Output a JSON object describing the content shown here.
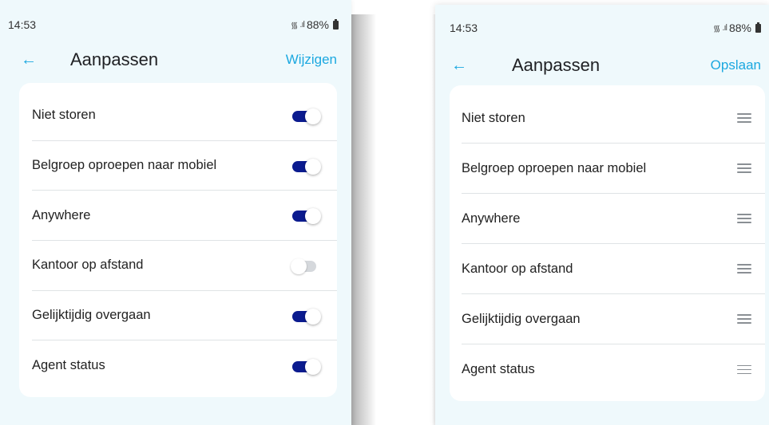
{
  "left_screen": {
    "status": {
      "time": "14:53",
      "battery": "88%"
    },
    "header": {
      "back_icon": "arrow-left-icon",
      "title": "Aanpassen",
      "action": "Wijzigen"
    },
    "colors": {
      "accent": "#1ba8e0",
      "toggle_on": "#0b1b8f",
      "toggle_off": "#d5d8dc",
      "background": "#eff9fc"
    },
    "items": [
      {
        "label": "Niet storen",
        "enabled": true
      },
      {
        "label": "Belgroep oproepen naar mobiel",
        "enabled": true
      },
      {
        "label": "Anywhere",
        "enabled": true
      },
      {
        "label": "Kantoor op afstand",
        "enabled": false
      },
      {
        "label": "Gelijktijdig overgaan",
        "enabled": true
      },
      {
        "label": "Agent status",
        "enabled": true
      }
    ]
  },
  "right_screen": {
    "status": {
      "time": "14:53",
      "battery": "88%"
    },
    "header": {
      "back_icon": "arrow-left-icon",
      "title": "Aanpassen",
      "action": "Opslaan"
    },
    "items": [
      {
        "label": "Niet storen",
        "handle_icon": "drag-handle-icon"
      },
      {
        "label": "Belgroep oproepen naar mobiel",
        "handle_icon": "drag-handle-icon"
      },
      {
        "label": "Anywhere",
        "handle_icon": "drag-handle-icon"
      },
      {
        "label": "Kantoor op afstand",
        "handle_icon": "drag-handle-icon"
      },
      {
        "label": "Gelijktijdig overgaan",
        "handle_icon": "drag-handle-icon"
      },
      {
        "label": "Agent status",
        "handle_icon": "drag-handle-icon"
      }
    ]
  }
}
